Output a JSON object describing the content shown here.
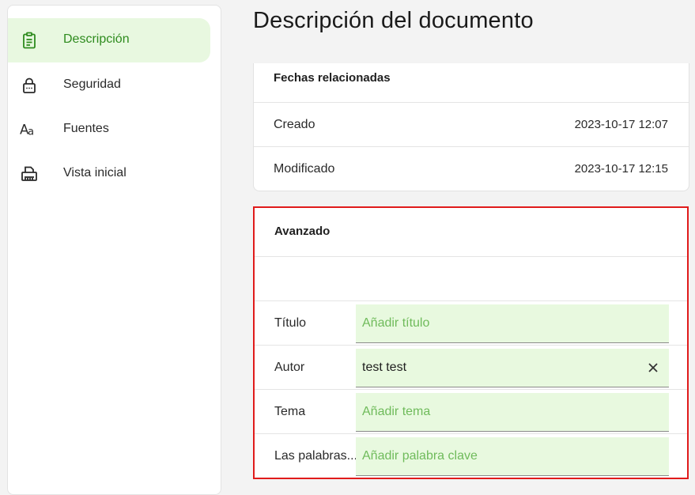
{
  "sidebar": {
    "items": [
      {
        "label": "Descripción",
        "icon": "clipboard-icon",
        "active": true
      },
      {
        "label": "Seguridad",
        "icon": "lock-icon",
        "active": false
      },
      {
        "label": "Fuentes",
        "icon": "font-icon",
        "active": false
      },
      {
        "label": "Vista inicial",
        "icon": "printer-icon",
        "active": false
      }
    ]
  },
  "main": {
    "title": "Descripción del documento",
    "dates": {
      "header": "Fechas relacionadas",
      "rows": [
        {
          "label": "Creado",
          "value": "2023-10-17 12:07"
        },
        {
          "label": "Modificado",
          "value": "2023-10-17 12:15"
        }
      ]
    },
    "advanced": {
      "header": "Avanzado",
      "fields": [
        {
          "label": "Título",
          "value": "",
          "placeholder": "Añadir título"
        },
        {
          "label": "Autor",
          "value": "test test",
          "placeholder": ""
        },
        {
          "label": "Tema",
          "value": "",
          "placeholder": "Añadir tema"
        },
        {
          "label": "Las palabras...",
          "value": "",
          "placeholder": "Añadir palabra clave"
        }
      ]
    }
  },
  "colors": {
    "accent": "#2e8b1e",
    "active_bg": "#e8f8e0",
    "field_bg": "#e8f9df",
    "highlight_border": "#e01b1b"
  }
}
